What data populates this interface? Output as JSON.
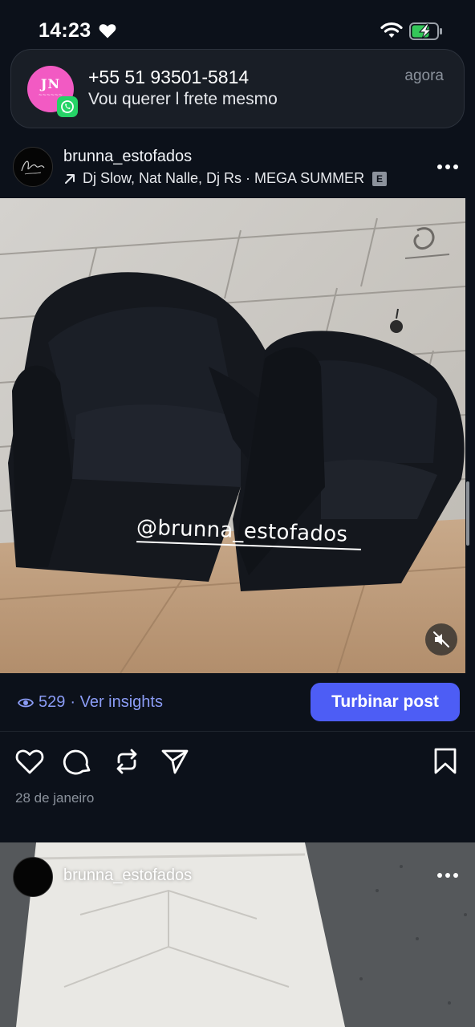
{
  "status_bar": {
    "time": "14:23",
    "icons": [
      "heart-icon",
      "wifi-icon",
      "battery-charging-icon"
    ]
  },
  "notification": {
    "app_icon": "whatsapp-icon",
    "avatar_initials": "JN",
    "title": "+55 51 93501-5814",
    "message": "Vou querer l frete mesmo",
    "time": "agora"
  },
  "post": {
    "username": "brunna_estofados",
    "music": "Dj Slow, Nat Nalle, Dj Rs · MEGA SUMMER",
    "explicit_badge": "E",
    "photo_watermark": "@brunna_estofados",
    "views": "529",
    "insights_label": "· Ver insights",
    "boost_label": "Turbinar post",
    "date": "28 de janeiro"
  },
  "next_post": {
    "username": "brunna_estofados"
  },
  "colors": {
    "background": "#0c111a",
    "accent": "#4d5df5",
    "link": "#8b9cf5",
    "muted_text": "#8b929c",
    "whatsapp": "#25d366",
    "avatar_pink": "#f25ac3"
  }
}
